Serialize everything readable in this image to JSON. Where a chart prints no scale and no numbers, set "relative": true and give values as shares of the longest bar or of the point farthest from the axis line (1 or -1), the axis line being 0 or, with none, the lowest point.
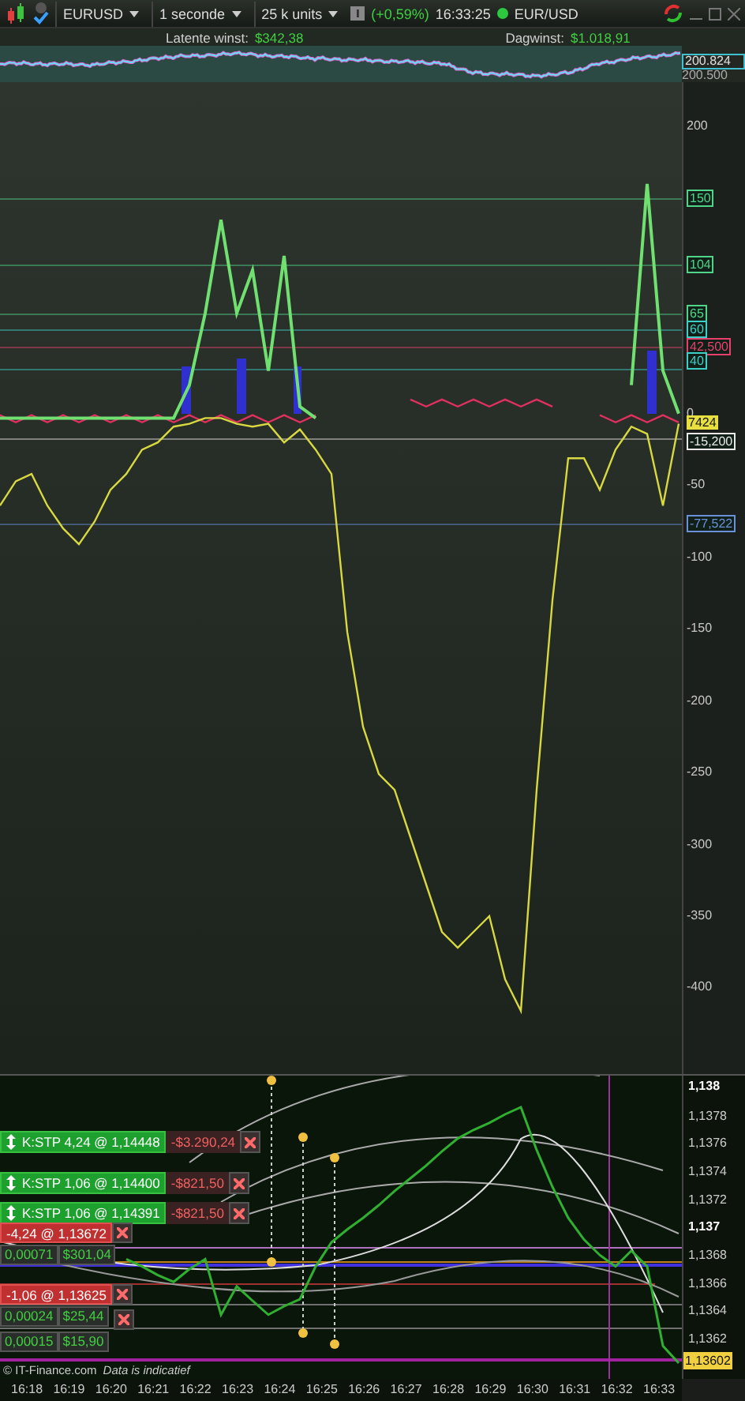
{
  "toolbar": {
    "instrument": "EURUSD",
    "interval": "1 seconde",
    "size": "25 k units",
    "change": "(+0,59%)",
    "time": "16:33:25",
    "market": "EUR/USD"
  },
  "summary": {
    "latent_label": "Latente winst:",
    "latent_value": "$342,38",
    "day_label": "Dagwinst:",
    "day_value": "$1.018,91"
  },
  "overview_chart": {
    "axis_labels": [
      {
        "text": "200.824",
        "kind": "current"
      },
      {
        "text": "200.500",
        "kind": "tick"
      }
    ]
  },
  "indicator_chart": {
    "level_tags": [
      {
        "text": "150",
        "kind": "tag",
        "color": "#4fd48a"
      },
      {
        "text": "104",
        "kind": "tag",
        "color": "#4fd48a"
      },
      {
        "text": "65",
        "kind": "tag",
        "color": "#4fd48a"
      },
      {
        "text": "60",
        "kind": "tag",
        "color": "#3cd0c8"
      },
      {
        "text": "42,500",
        "kind": "tag",
        "color": "#e8406a"
      },
      {
        "text": "40",
        "kind": "tag",
        "color": "#3cd0c8"
      },
      {
        "text": "7424",
        "kind": "current"
      },
      {
        "text": "-15,200",
        "kind": "tag",
        "color": "#e8e8e8"
      },
      {
        "text": "-77,522",
        "kind": "tag",
        "color": "#6a90d8"
      }
    ],
    "chart_data": {
      "type": "line",
      "ylim": [
        -460,
        231
      ],
      "yticks": [
        200,
        0,
        -50,
        -100,
        -150,
        -200,
        -250,
        -300,
        -350,
        -400
      ],
      "series": [
        {
          "color": "#e03060",
          "values": [
            -1,
            -6,
            -1,
            -6,
            -1,
            -6,
            -1,
            -6,
            -1,
            -6,
            -1,
            -6,
            -1,
            -6,
            -1,
            -6,
            -1,
            -6,
            -1,
            -6,
            -1,
            null,
            null,
            null,
            null,
            null,
            10,
            5,
            10,
            5,
            10,
            5,
            10,
            5,
            10,
            5,
            null,
            null,
            -1,
            -6,
            -1,
            -6,
            -1,
            -6
          ]
        },
        {
          "color": "#d8d840",
          "values": [
            -64,
            -47,
            -42,
            -64,
            -80,
            -91,
            -75,
            -53,
            -42,
            -25,
            -20,
            -9,
            -7,
            -3,
            -3,
            -7,
            -9,
            -7,
            -20,
            -11,
            -25,
            -42,
            -152,
            -218,
            -251,
            -262,
            -295,
            -328,
            -361,
            -372,
            -361,
            -350,
            -394,
            -416,
            -262,
            -130,
            -31,
            -31,
            -53,
            -25,
            -9,
            -14,
            -64,
            -7
          ]
        },
        {
          "color": "#70e070",
          "values": [
            -3,
            -3,
            -3,
            -3,
            -3,
            -3,
            -3,
            -3,
            -3,
            -3,
            -3,
            -3,
            20,
            70,
            135,
            70,
            100,
            30,
            110,
            5,
            -3,
            null,
            null,
            null,
            null,
            null,
            null,
            null,
            null,
            null,
            null,
            null,
            null,
            null,
            null,
            null,
            null,
            null,
            null,
            null,
            20,
            160,
            30,
            0
          ]
        }
      ]
    }
  },
  "price_chart": {
    "axis_labels": [
      {
        "text": "1,138",
        "kind": "major"
      },
      {
        "text": "1,1378",
        "kind": "tick"
      },
      {
        "text": "1,1376",
        "kind": "tick"
      },
      {
        "text": "1,1374",
        "kind": "tick"
      },
      {
        "text": "1,1372",
        "kind": "tick"
      },
      {
        "text": "1,137",
        "kind": "major"
      },
      {
        "text": "1,1368",
        "kind": "tick"
      },
      {
        "text": "1,1366",
        "kind": "tick"
      },
      {
        "text": "1,1364",
        "kind": "tick"
      },
      {
        "text": "1,1362",
        "kind": "tick"
      },
      {
        "text": "1,13602",
        "kind": "current"
      }
    ],
    "chart_data": {
      "type": "line",
      "relative": true,
      "series": [
        {
          "color": "#30b030",
          "values": [
            null,
            null,
            null,
            null,
            null,
            null,
            null,
            null,
            0.406,
            0.378,
            0.344,
            0.317,
            0.367,
            0.406,
            0.189,
            0.3,
            0.244,
            0.189,
            0.222,
            0.25,
            0.378,
            0.472,
            0.522,
            0.567,
            0.617,
            0.672,
            0.722,
            0.772,
            0.828,
            0.878,
            0.911,
            0.939,
            0.972,
            1,
            0.833,
            0.689,
            0.567,
            0.483,
            0.422,
            0.378,
            0.439,
            0.378,
            0.067,
            0
          ]
        }
      ]
    },
    "orders": [
      {
        "label": "K:STP 4,24 @ 1,14448",
        "pnl": "-$3.290,24"
      },
      {
        "label": "K:STP 1,06 @ 1,14400",
        "pnl": "-$821,50"
      },
      {
        "label": "K:STP 1,06 @ 1,14391",
        "pnl": "-$821,50"
      }
    ],
    "positions": [
      {
        "label": "-4,24 @ 1,13672",
        "pips": "0,00071",
        "profit": "$301,04"
      },
      {
        "label": "-1,06 @ 1,13625",
        "pips": "0,00024",
        "profit": "$25,44"
      },
      {
        "pips": "0,00015",
        "profit": "$15,90"
      }
    ],
    "copyright": "© IT-Finance.com",
    "disclaimer": "Data is indicatief",
    "time_labels": [
      "16:18",
      "16:19",
      "16:20",
      "16:21",
      "16:22",
      "16:23",
      "16:24",
      "16:25",
      "16:26",
      "16:27",
      "16:28",
      "16:29",
      "16:30",
      "16:31",
      "16:32",
      "16:33"
    ]
  }
}
